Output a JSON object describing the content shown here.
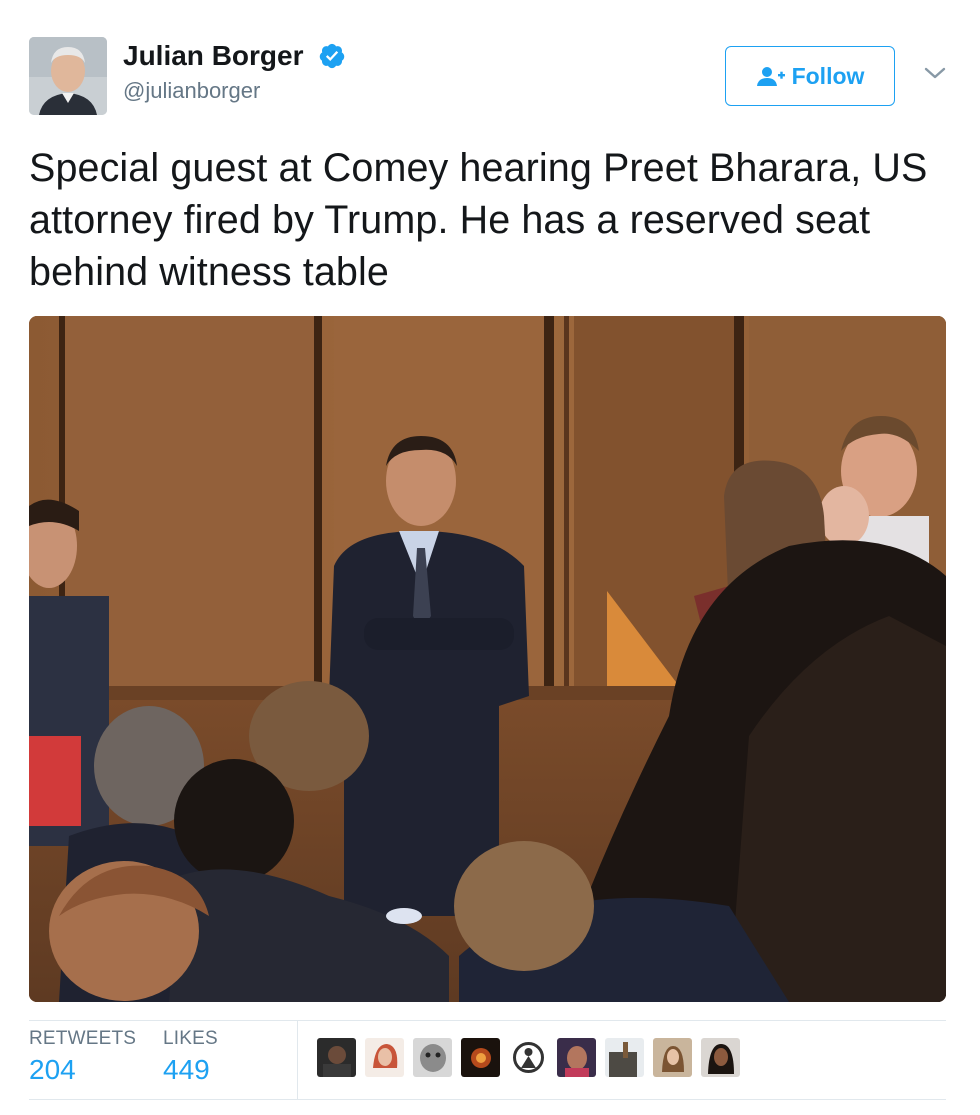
{
  "author": {
    "display_name": "Julian Borger",
    "handle": "@julianborger",
    "verified_icon": "verified-badge-icon",
    "avatar_icon": "avatar"
  },
  "follow_button": {
    "label": "Follow",
    "icon": "add-user-icon"
  },
  "menu_caret": "chevron-down-icon",
  "tweet": {
    "text": "Special guest at Comey hearing Preet Bharara, US attorney fired by Trump. He has a reserved seat behind witness table"
  },
  "stats": {
    "retweets_label": "RETWEETS",
    "retweets_value": "204",
    "likes_label": "LIKES",
    "likes_value": "449"
  },
  "likers_count_shown": 9,
  "colors": {
    "accent": "#1da1f2",
    "text": "#14171a",
    "secondary": "#657786",
    "divider": "#e1e8ed"
  }
}
